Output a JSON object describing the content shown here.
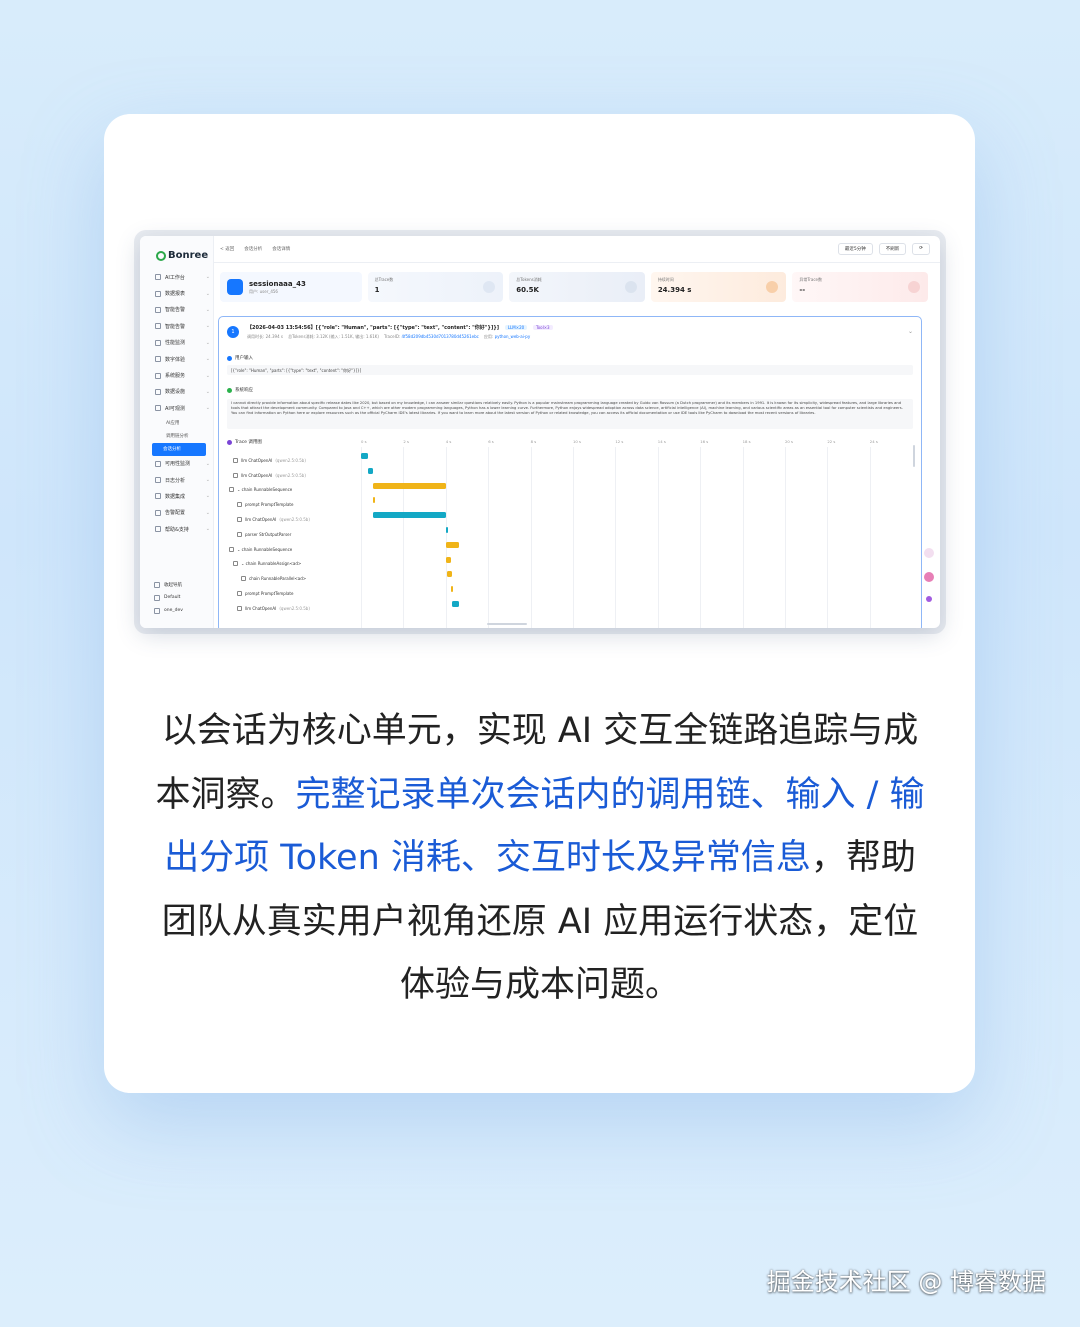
{
  "sidebar": {
    "logo": "Bonree",
    "items": [
      {
        "label": "AI工作台"
      },
      {
        "label": "数据报表"
      },
      {
        "label": "智能告警"
      },
      {
        "label": "智能告警"
      },
      {
        "label": "性能监测"
      },
      {
        "label": "数字体验"
      },
      {
        "label": "系统服务"
      },
      {
        "label": "数据设施"
      },
      {
        "label": "AI可观测"
      }
    ],
    "sub_items": [
      {
        "label": "AI应用"
      },
      {
        "label": "调用链分析"
      },
      {
        "label": "会话分析",
        "active": true
      }
    ],
    "items2": [
      {
        "label": "可用性监测"
      },
      {
        "label": "日志分析"
      },
      {
        "label": "数据集成"
      },
      {
        "label": "告警配置"
      },
      {
        "label": "帮助&支持"
      }
    ],
    "footer": [
      {
        "label": "收起导航"
      },
      {
        "label": "Default"
      },
      {
        "label": "one_dev"
      }
    ]
  },
  "topbar": {
    "back": "< 返回",
    "crumbs": [
      "会话分析",
      "会话详情"
    ],
    "time_range": "最近5分钟",
    "refresh": "不刷新"
  },
  "stats": {
    "session_name": "sessionaaa_43",
    "user": "用户: user_456",
    "trace_label": "总Trace数",
    "trace_value": "1",
    "tokens_label": "总Tokens消耗",
    "tokens_value": "60.5K",
    "duration_label": "持续时间",
    "duration_value": "24.394 s",
    "error_label": "异常Trace数",
    "error_value": "--"
  },
  "panel": {
    "index": "1",
    "title": "【2026-04-03 13:54:56】[{\"role\": \"Human\", \"parts\": [{\"type\": \"text\", \"content\": \"你好\"}]}]",
    "tag_llm": "LLM×20",
    "tag_tool": "Tool×3",
    "meta_duration": "调用时长:  24.394 s",
    "meta_tokens": "总Tokens消耗:  3.12K (输入: 1.51K, 输出: 1.61K)",
    "meta_trace_label": "TraceID:",
    "meta_trace": "4f58d209db4530d7013780d45261ebc",
    "meta_app_label": "应用:",
    "meta_app": "python_web-ai-py",
    "input_label": "用户输入",
    "input_text": "[{\"role\": \"Human\", \"parts\": [{\"type\": \"text\", \"content\": \"你好\"}]}]",
    "output_label": "系统响应",
    "output_text": "I cannot directly provide information about specific release dates like 2020, but based on my knowledge, I can answer similar questions relatively easily. Python is a popular mainstream programming language created by Guido van Rossum (a Dutch programmer) and its members in 1991. It is known for its simplicity, widespread features, and large libraries and tools that attract the development community. Compared to Java and C++, which are other modern programming languages, Python has a lower learning curve. Furthermore, Python enjoys widespread adoption across data science, artificial intelligence (AI), machine learning, and various scientific areas as an essential tool for computer scientists and engineers. You can find information on Python here or explore resources such as the official PyCharm IDE's latest libraries. If you want to learn more about the latest version of Python or related knowledge, you can access its official documentation or use IDE tools like PyCharm to download the most recent versions of libraries.",
    "trace_label": "Trace 调用图"
  },
  "trace_rows": [
    {
      "indent": 1,
      "name": "llm ChatOpenAI",
      "model": "(qwen2.5:0.5b)"
    },
    {
      "indent": 1,
      "name": "llm ChatOpenAI",
      "model": "(qwen2.5:0.5b)"
    },
    {
      "indent": 0,
      "name": "⌄ chain RunnableSequence",
      "model": ""
    },
    {
      "indent": 2,
      "name": "prompt PromptTemplate",
      "model": ""
    },
    {
      "indent": 2,
      "name": "llm ChatOpenAI",
      "model": "(qwen2.5:0.5b)"
    },
    {
      "indent": 2,
      "name": "parser StrOutputParser",
      "model": ""
    },
    {
      "indent": 0,
      "name": "⌄ chain RunnableSequence",
      "model": ""
    },
    {
      "indent": 1,
      "name": "⌄ chain RunnableAssign<ad>",
      "model": ""
    },
    {
      "indent": 3,
      "name": "chain RunnableParallel<ad>",
      "model": ""
    },
    {
      "indent": 2,
      "name": "prompt PromptTemplate",
      "model": ""
    },
    {
      "indent": 2,
      "name": "llm ChatOpenAI",
      "model": "(qwen2.5:0.5b)"
    }
  ],
  "chart_data": {
    "type": "bar",
    "x_ticks": [
      "0 s",
      "2 s",
      "4 s",
      "6 s",
      "8 s",
      "10 s",
      "12 s",
      "14 s",
      "16 s",
      "18 s",
      "20 s",
      "22 s",
      "24 s"
    ],
    "xlim": [
      0,
      25
    ],
    "spans": [
      {
        "kind": "llm",
        "start": 0.0,
        "end": 0.35
      },
      {
        "kind": "llm",
        "start": 0.35,
        "end": 0.55
      },
      {
        "kind": "chain",
        "start": 0.55,
        "end": 4.0
      },
      {
        "kind": "chain",
        "start": 0.55,
        "end": 0.65
      },
      {
        "kind": "llm",
        "start": 0.55,
        "end": 4.0
      },
      {
        "kind": "llm",
        "start": 4.0,
        "end": 4.1
      },
      {
        "kind": "chain",
        "start": 4.0,
        "end": 4.6
      },
      {
        "kind": "chain",
        "start": 4.0,
        "end": 4.25
      },
      {
        "kind": "chain",
        "start": 4.05,
        "end": 4.3
      },
      {
        "kind": "chain",
        "start": 4.25,
        "end": 4.35
      },
      {
        "kind": "llm",
        "start": 4.3,
        "end": 4.6
      }
    ],
    "colors": {
      "llm": "#13a8c5",
      "chain": "#f0b418"
    }
  },
  "description": {
    "part1": "以会话为核心单元，实现 AI 交互全链路追踪与成本洞察。",
    "part2": "完整记录单次会话内的调用链、输入 / 输出分项 Token 消耗、交互时长及异常信息",
    "part3": "，帮助团队从真实用户视角还原 AI 应用运行状态，定位体验与成本问题。"
  },
  "watermark": "掘金技术社区 @ 博睿数据"
}
